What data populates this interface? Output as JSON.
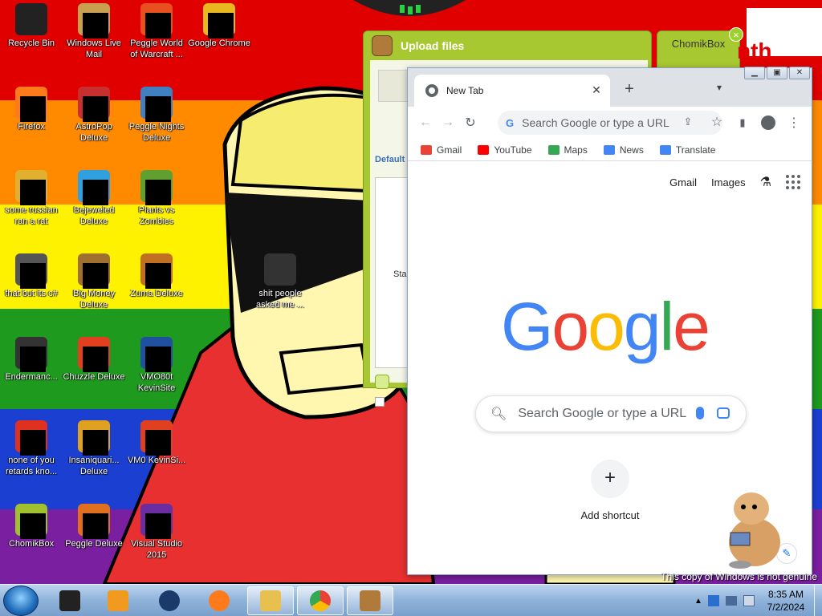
{
  "desktop_icons": [
    {
      "label": "Recycle Bin",
      "color": "#222222"
    },
    {
      "label": "Windows Live Mail",
      "color": "#c8a050"
    },
    {
      "label": "Peggle World of Warcraft ...",
      "color": "#e85020"
    },
    {
      "label": "Google Chrome",
      "color": "#e8b820"
    },
    {
      "label": "Firefox",
      "color": "#ff7a1a"
    },
    {
      "label": "AstroPop Deluxe",
      "color": "#c83030"
    },
    {
      "label": "Peggle Nights Deluxe",
      "color": "#4080c0"
    },
    {
      "label": "some russian ran a rat",
      "color": "#e0b030"
    },
    {
      "label": "Bejeweled Deluxe",
      "color": "#30a0e0"
    },
    {
      "label": "Plants vs Zombies",
      "color": "#60a030"
    },
    {
      "label": "that but its c#",
      "color": "#555555"
    },
    {
      "label": "Big Money Deluxe",
      "color": "#a07030"
    },
    {
      "label": "Zuma Deluxe",
      "color": "#c07020"
    },
    {
      "label": "shit people asked me ...",
      "color": "#333333"
    },
    {
      "label": "Endermanc...",
      "color": "#333333"
    },
    {
      "label": "Chuzzle Deluxe",
      "color": "#e04020"
    },
    {
      "label": "VMO80t KevinSite",
      "color": "#2050a0"
    },
    {
      "label": "none of you retards kno...",
      "color": "#e03020"
    },
    {
      "label": "Insaniquari... Deluxe",
      "color": "#e0a020"
    },
    {
      "label": "VM0 KevinSi...",
      "color": "#e04020"
    },
    {
      "label": "ChomikBox",
      "color": "#a0c030"
    },
    {
      "label": "Peggle Deluxe",
      "color": "#e07020"
    },
    {
      "label": "Visual Studio 2015",
      "color": "#6a2ea0"
    }
  ],
  "upload_window": {
    "title": "Upload files",
    "side_label_1": "Default",
    "side_label_2": "Sta",
    "chomik_tab": "ChomikBox",
    "partial_text": "nth"
  },
  "chrome": {
    "tab_title": "New Tab",
    "omnibox_placeholder": "Search Google or type a URL",
    "bookmarks": [
      {
        "label": "Gmail",
        "color": "#ea4335"
      },
      {
        "label": "YouTube",
        "color": "#ff0000"
      },
      {
        "label": "Maps",
        "color": "#34a853"
      },
      {
        "label": "News",
        "color": "#4285f4"
      },
      {
        "label": "Translate",
        "color": "#4285f4"
      }
    ],
    "ntp_links": {
      "gmail": "Gmail",
      "images": "Images"
    },
    "logo_letters": [
      {
        "ch": "G",
        "color": "#4285f4"
      },
      {
        "ch": "o",
        "color": "#ea4335"
      },
      {
        "ch": "o",
        "color": "#fbbc05"
      },
      {
        "ch": "g",
        "color": "#4285f4"
      },
      {
        "ch": "l",
        "color": "#34a853"
      },
      {
        "ch": "e",
        "color": "#ea4335"
      }
    ],
    "search_placeholder": "Search Google or type a URL",
    "add_shortcut": "Add shortcut"
  },
  "taskbar": {
    "time": "8:35 AM",
    "date": "7/2/2024",
    "genuine_text": "This copy of Windows is not genuine"
  }
}
